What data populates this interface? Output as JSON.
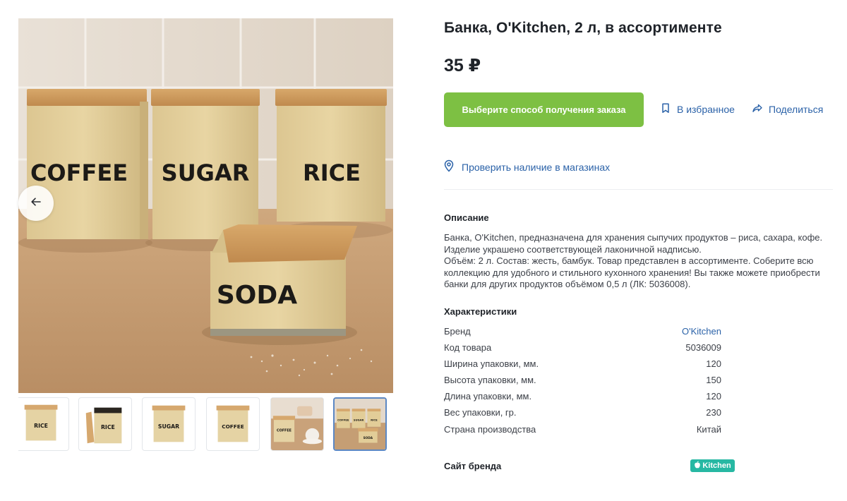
{
  "product": {
    "title": "Банка, O'Kitchen, 2 л, в ассортименте",
    "price": "35 ₽"
  },
  "actions": {
    "order_label": "Выберите способ получения заказа",
    "favorite_label": "В избранное",
    "share_label": "Поделиться",
    "stores_label": "Проверить наличие в магазинах"
  },
  "gallery": {
    "main_labels": [
      "COFFEE",
      "SUGAR",
      "RICE",
      "SODA"
    ],
    "thumbnails": [
      {
        "label": "RICE",
        "active": false
      },
      {
        "label": "RICE",
        "active": false
      },
      {
        "label": "SUGAR",
        "active": false
      },
      {
        "label": "COFFEE",
        "active": false
      },
      {
        "label": "COFFEE",
        "active": false
      },
      {
        "labels": [
          "COFFEE",
          "SUGAR",
          "RICE",
          "SODA"
        ],
        "active": true
      }
    ]
  },
  "description": {
    "title": "Описание",
    "paragraphs": [
      "Банка, O'Kitchen, предназначена для хранения сыпучих продуктов – риса, сахара, кофе. Изделие украшено соответствующей лаконичной надписью.",
      "Объём: 2 л. Состав: жесть, бамбук. Товар представлен в ассортименте. Соберите всю коллекцию для удобного и стильного кухонного хранения! Вы также можете приобрести банки для других продуктов объёмом 0,5 л (ЛК: 5036008)."
    ]
  },
  "characteristics": {
    "title": "Характеристики",
    "rows": [
      {
        "label": "Бренд",
        "value": "O'Kitchen"
      },
      {
        "label": "Код товара",
        "value": "5036009"
      },
      {
        "label": "Ширина упаковки, мм.",
        "value": "120"
      },
      {
        "label": "Высота упаковки, мм.",
        "value": "150"
      },
      {
        "label": "Длина упаковки, мм.",
        "value": "120"
      },
      {
        "label": "Вес упаковки, гр.",
        "value": "230"
      },
      {
        "label": "Страна производства",
        "value": "Китай"
      }
    ]
  },
  "brand_site": {
    "title": "Сайт бренда",
    "badge_text": "Kitchen"
  },
  "colors": {
    "accent_green": "#7dc043",
    "link_blue": "#2b62a8",
    "brand_teal": "#27b8a3"
  },
  "icons": [
    "arrow-left-icon",
    "bookmark-icon",
    "share-icon",
    "location-pin-icon",
    "apple-icon"
  ]
}
